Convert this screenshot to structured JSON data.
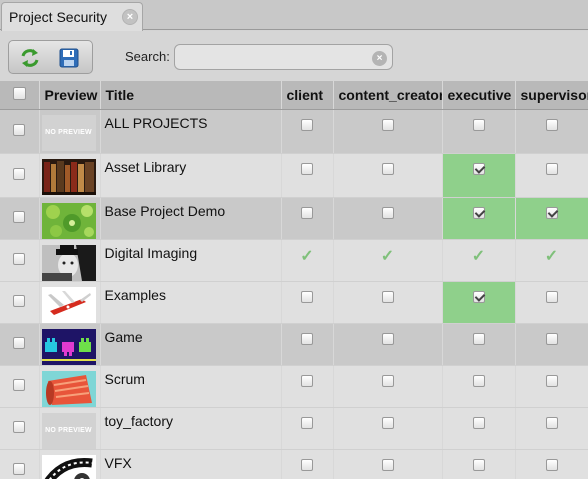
{
  "tab": {
    "title": "Project Security",
    "close": "×"
  },
  "toolbar": {
    "search_label": "Search:",
    "search_value": "",
    "search_placeholder": "",
    "clear": "×"
  },
  "grid": {
    "columns": {
      "preview": "Preview",
      "title": "Title",
      "client": "client",
      "content_creator": "content_creator",
      "executive": "executive",
      "supervisor": "supervisor"
    },
    "no_preview": "NO PREVIEW",
    "rows": [
      {
        "title": "ALL PROJECTS",
        "thumb": "none",
        "perm": [
          "off",
          "off",
          "off",
          "off"
        ]
      },
      {
        "title": "Asset Library",
        "thumb": "library",
        "perm": [
          "off",
          "off",
          "checked",
          "off"
        ]
      },
      {
        "title": "Base Project Demo",
        "thumb": "green",
        "perm": [
          "off",
          "off",
          "checked",
          "checked"
        ]
      },
      {
        "title": "Digital Imaging",
        "thumb": "bw",
        "perm": [
          "tick",
          "tick",
          "tick",
          "tick"
        ]
      },
      {
        "title": "Examples",
        "thumb": "knife",
        "perm": [
          "off",
          "off",
          "checked",
          "off"
        ]
      },
      {
        "title": "Game",
        "thumb": "game",
        "perm": [
          "off",
          "off",
          "off",
          "off"
        ]
      },
      {
        "title": "Scrum",
        "thumb": "scrum",
        "perm": [
          "off",
          "off",
          "off",
          "off"
        ]
      },
      {
        "title": "toy_factory",
        "thumb": "none",
        "perm": [
          "off",
          "off",
          "off",
          "off"
        ]
      },
      {
        "title": "VFX",
        "thumb": "film",
        "perm": [
          "off",
          "off",
          "off",
          "off"
        ]
      }
    ]
  },
  "colors": {
    "granted": "#8fd08b",
    "header": "#b9b9b9",
    "row_light": "#e0e0e0",
    "row_dark": "#c9c9c9"
  },
  "icons": {
    "refresh": "refresh-icon",
    "save": "save-icon",
    "clear": "clear-search-icon",
    "tab_close": "close-icon"
  }
}
